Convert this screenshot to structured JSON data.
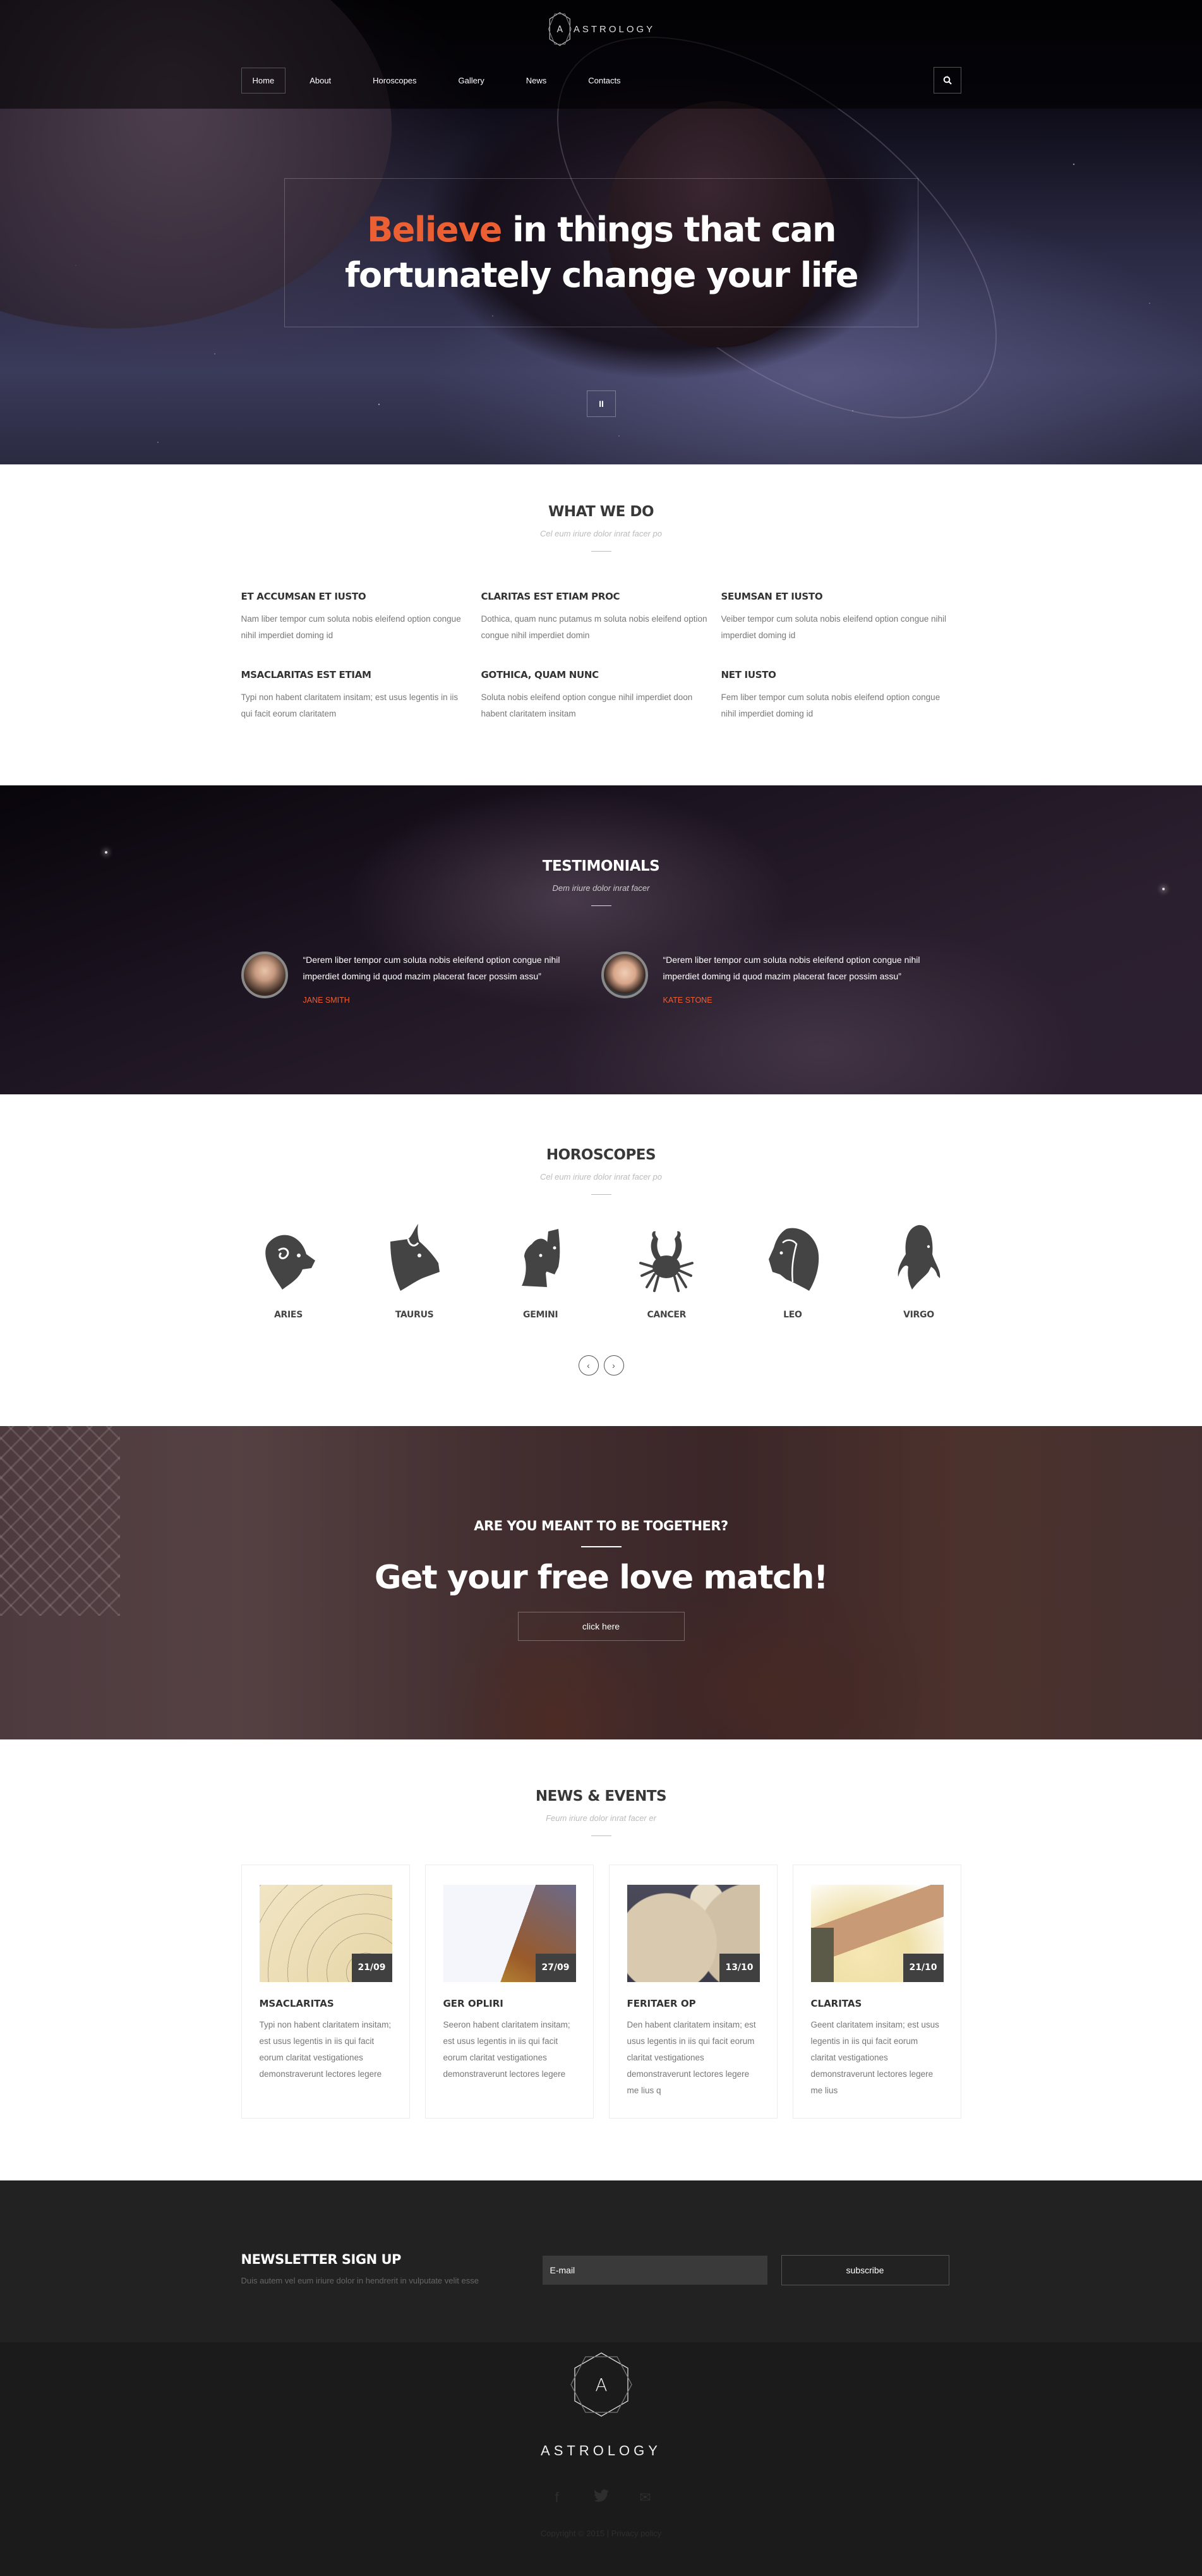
{
  "header": {
    "brand": "ASTROLOGY",
    "logo_letter": "A",
    "nav": [
      {
        "label": "Home",
        "active": true
      },
      {
        "label": "About"
      },
      {
        "label": "Horoscopes"
      },
      {
        "label": "Gallery"
      },
      {
        "label": "News"
      },
      {
        "label": "Contacts"
      }
    ],
    "search_icon": "search-icon"
  },
  "hero": {
    "title_accent": "Believe",
    "title_rest_line1": " in things that can",
    "title_line2": "fortunately change your life",
    "pause_icon": "pause-icon",
    "pause_glyph": "II",
    "accent_color": "#ec5f33"
  },
  "what_we_do": {
    "title": "WHAT WE DO",
    "subtitle": "Cel eum iriure dolor inrat facer po",
    "items": [
      {
        "title": "ET ACCUMSAN ET IUSTO",
        "text": "Nam liber tempor cum soluta nobis eleifend option congue nihil imperdiet doming id"
      },
      {
        "title": "CLARITAS EST ETIAM PROC",
        "text": "Dothica, quam nunc putamus m soluta nobis eleifend option congue nihil imperdiet domin"
      },
      {
        "title": "SEUMSAN ET IUSTO",
        "text": "Veiber tempor cum soluta nobis eleifend option congue nihil imperdiet doming id"
      },
      {
        "title": "MSACLARITAS EST ETIAM",
        "text": "Typi non habent claritatem insitam; est usus legentis in iis qui facit eorum claritatem"
      },
      {
        "title": "GOTHICA, QUAM NUNC",
        "text": "Soluta nobis eleifend option congue nihil imperdiet doon habent claritatem insitam"
      },
      {
        "title": "NET IUSTO",
        "text": "Fem liber tempor cum soluta nobis eleifend option congue nihil imperdiet doming id"
      }
    ]
  },
  "testimonials": {
    "title": "TESTIMONIALS",
    "subtitle": "Dem iriure dolor inrat facer",
    "items": [
      {
        "quote": "“Derem liber tempor cum soluta nobis eleifend option congue nihil imperdiet doming id quod mazim placerat facer possim assu”",
        "name": "JANE SMITH"
      },
      {
        "quote": "“Derem liber tempor cum soluta nobis eleifend option congue nihil imperdiet doming id quod mazim placerat facer possim assu”",
        "name": "KATE STONE"
      }
    ]
  },
  "horoscopes": {
    "title": "HOROSCOPES",
    "subtitle": "Cel eum iriure dolor inrat facer po",
    "signs": [
      {
        "name": "ARIES",
        "icon": "aries-icon"
      },
      {
        "name": "TAURUS",
        "icon": "taurus-icon"
      },
      {
        "name": "GEMINI",
        "icon": "gemini-icon"
      },
      {
        "name": "CANCER",
        "icon": "cancer-icon"
      },
      {
        "name": "LEO",
        "icon": "leo-icon"
      },
      {
        "name": "VIRGO",
        "icon": "virgo-icon"
      }
    ],
    "prev_glyph": "‹",
    "next_glyph": "›"
  },
  "love_match": {
    "kicker": "ARE YOU MEANT TO BE TOGETHER?",
    "title": "Get your free love match!",
    "button": "click here"
  },
  "news": {
    "title": "NEWS & EVENTS",
    "subtitle": "Feum iriure dolor inrat facer er",
    "items": [
      {
        "date": "21/09",
        "title": "MSACLARITAS",
        "text": "Typi non habent claritatem insitam; est usus legentis in iis qui facit eorum claritat vestigationes demonstraverunt lectores legere"
      },
      {
        "date": "27/09",
        "title": "GER OPLIRI",
        "text": "Seeron habent claritatem insitam; est usus legentis in iis qui facit eorum claritat vestigationes demonstraverunt lectores legere"
      },
      {
        "date": "13/10",
        "title": "FERITAER OP",
        "text": "Den habent claritatem insitam; est usus legentis in iis qui facit eorum claritat vestigationes demonstraverunt lectores legere me lius q"
      },
      {
        "date": "21/10",
        "title": "CLARITAS",
        "text": "Geent claritatem insitam; est usus legentis in iis qui facit eorum claritat vestigationes demonstraverunt lectores legere me lius"
      }
    ]
  },
  "newsletter": {
    "title": "NEWSLETTER SIGN UP",
    "description": "Duis autem vel eum iriure dolor in hendrerit in vulputate velit esse",
    "email_placeholder": "E-mail",
    "email_value": "",
    "button": "subscribe"
  },
  "footer": {
    "brand": "ASTROLOGY",
    "logo_letter": "A",
    "socials": [
      {
        "icon": "facebook-icon",
        "glyph": "f"
      },
      {
        "icon": "twitter-icon",
        "glyph": "🐦"
      },
      {
        "icon": "email-icon",
        "glyph": "✉"
      }
    ],
    "copyright": "Copyright © 2015 |",
    "privacy": "Privacy policy"
  }
}
